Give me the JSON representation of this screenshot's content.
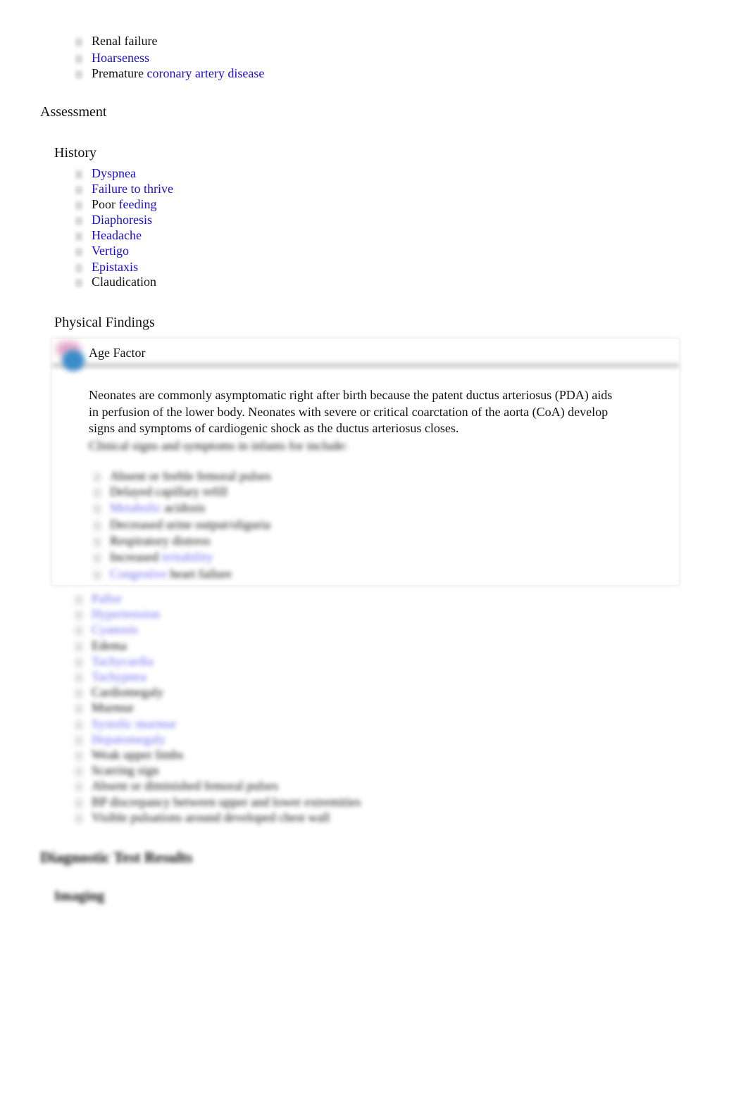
{
  "top_list": [
    [
      {
        "t": "Renal failure"
      }
    ],
    [
      {
        "t": "Hoarseness",
        "link": true
      }
    ],
    [
      {
        "t": "Premature "
      },
      {
        "t": "coronary artery disease",
        "link": true
      }
    ]
  ],
  "assessment_heading": "Assessment",
  "history_heading": "History",
  "history_list": [
    [
      {
        "t": "Dyspnea",
        "link": true
      }
    ],
    [
      {
        "t": "Failure to thrive",
        "link": true
      }
    ],
    [
      {
        "t": "Poor "
      },
      {
        "t": "feeding",
        "link": true
      }
    ],
    [
      {
        "t": "Diaphoresis",
        "link": true
      }
    ],
    [
      {
        "t": "Headache",
        "link": true
      }
    ],
    [
      {
        "t": "Vertigo",
        "link": true
      }
    ],
    [
      {
        "t": "Epistaxis",
        "link": true
      }
    ],
    [
      {
        "t": "Claudication"
      }
    ]
  ],
  "physical_heading": "Physical Findings",
  "age_factor": {
    "title": "Age Factor",
    "icon": "age-factor-icon",
    "paragraph": "Neonates are commonly asymptomatic right after birth because the patent ductus arteriosus (PDA) aids in perfusion of the lower body. Neonates with severe or critical coarctation of the aorta (CoA) develop signs and symptoms of cardiogenic shock as the ductus arteriosus closes.",
    "blurred_intro": "Clinical signs and symptoms in infants for include:",
    "blurred_list": [
      [
        {
          "t": "Absent or feeble femoral pulses"
        }
      ],
      [
        {
          "t": "Delayed capillary refill"
        }
      ],
      [
        {
          "t": "Metabolic",
          "link": true
        },
        {
          "t": " acidosis"
        }
      ],
      [
        {
          "t": "Decreased urine output/oliguria"
        }
      ],
      [
        {
          "t": "Respiratory distress"
        }
      ],
      [
        {
          "t": "Increased "
        },
        {
          "t": "irritability",
          "link": true
        }
      ],
      [
        {
          "t": "Congestive",
          "link": true
        },
        {
          "t": " heart failure"
        }
      ]
    ]
  },
  "findings_list": [
    [
      {
        "t": "Pallor",
        "link": true
      }
    ],
    [
      {
        "t": "Hypertension",
        "link": true
      }
    ],
    [
      {
        "t": "Cyanosis",
        "link": true
      }
    ],
    [
      {
        "t": "Edema"
      }
    ],
    [
      {
        "t": "Tachycardia",
        "link": true
      }
    ],
    [
      {
        "t": "Tachypnea",
        "link": true
      }
    ],
    [
      {
        "t": "Cardiomegaly"
      }
    ],
    [
      {
        "t": "Murmur"
      }
    ],
    [
      {
        "t": "Systolic murmur",
        "link": true
      }
    ],
    [
      {
        "t": "Hepatomegaly",
        "link": true
      }
    ],
    [
      {
        "t": "Weak upper limbs"
      }
    ],
    [
      {
        "t": "Scarring sign"
      }
    ],
    [
      {
        "t": "Absent or diminished femoral pulses"
      }
    ],
    [
      {
        "t": "BP discrepancy between upper and lower extremities"
      }
    ],
    [
      {
        "t": "Visible pulsations around developed chest wall"
      }
    ]
  ],
  "diagnostic_heading": "Diagnostic Test Results",
  "imaging_heading": "Imaging"
}
